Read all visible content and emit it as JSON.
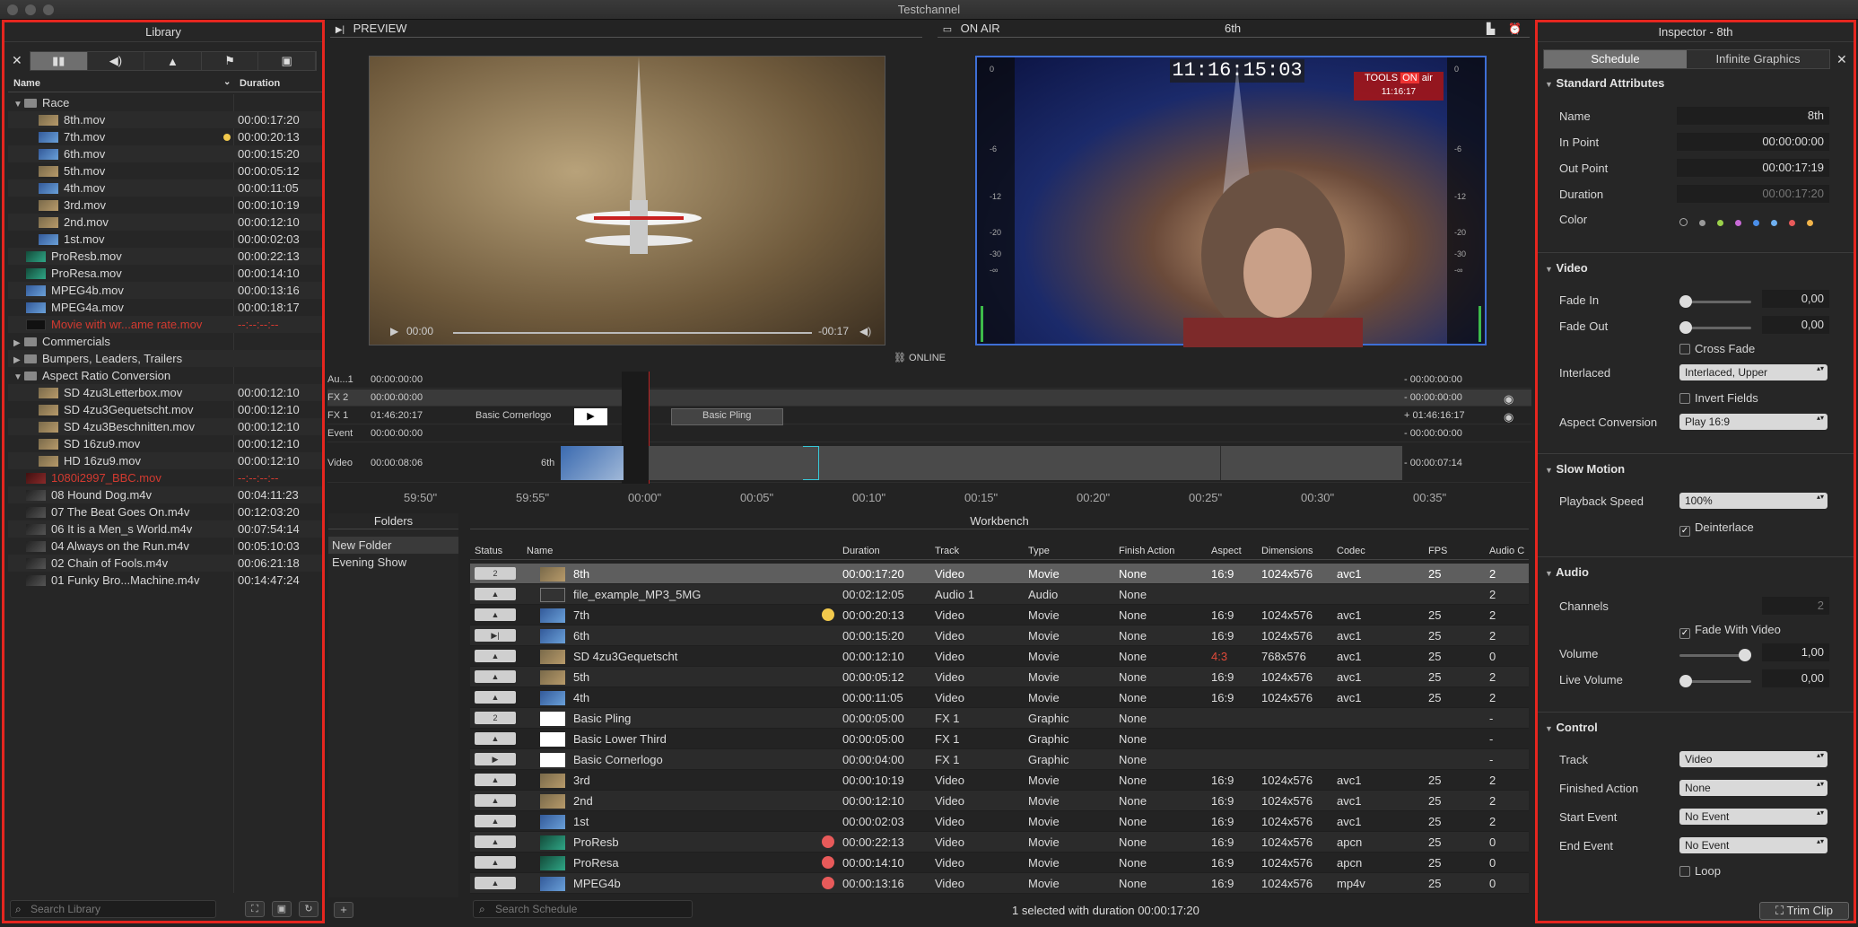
{
  "window": {
    "title": "Testchannel"
  },
  "library": {
    "title": "Library",
    "col_name": "Name",
    "col_duration": "Duration",
    "rows": [
      {
        "name": "Race",
        "dur": "",
        "type": "folder",
        "indent": 0,
        "open": true
      },
      {
        "name": "8th.mov",
        "dur": "00:00:17:20",
        "indent": 2,
        "thumb": "sand"
      },
      {
        "name": "7th.mov",
        "dur": "00:00:20:13",
        "indent": 2,
        "thumb": "blue",
        "dot": true
      },
      {
        "name": "6th.mov",
        "dur": "00:00:15:20",
        "indent": 2,
        "thumb": "blue"
      },
      {
        "name": "5th.mov",
        "dur": "00:00:05:12",
        "indent": 2,
        "thumb": "sand"
      },
      {
        "name": "4th.mov",
        "dur": "00:00:11:05",
        "indent": 2,
        "thumb": "blue"
      },
      {
        "name": "3rd.mov",
        "dur": "00:00:10:19",
        "indent": 2,
        "thumb": "sand"
      },
      {
        "name": "2nd.mov",
        "dur": "00:00:12:10",
        "indent": 2,
        "thumb": "sand"
      },
      {
        "name": "1st.mov",
        "dur": "00:00:02:03",
        "indent": 2,
        "thumb": "blue"
      },
      {
        "name": "ProResb.mov",
        "dur": "00:00:22:13",
        "indent": 1,
        "thumb": "green"
      },
      {
        "name": "ProResa.mov",
        "dur": "00:00:14:10",
        "indent": 1,
        "thumb": "green"
      },
      {
        "name": "MPEG4b.mov",
        "dur": "00:00:13:16",
        "indent": 1,
        "thumb": "blue"
      },
      {
        "name": "MPEG4a.mov",
        "dur": "00:00:18:17",
        "indent": 1,
        "thumb": "blue"
      },
      {
        "name": "Movie with wr...ame rate.mov",
        "dur": "--:--:--:--",
        "indent": 1,
        "thumb": "black",
        "red": true
      },
      {
        "name": "Commercials",
        "dur": "",
        "type": "folder",
        "indent": 0
      },
      {
        "name": "Bumpers, Leaders, Trailers",
        "dur": "",
        "type": "folder",
        "indent": 0
      },
      {
        "name": "Aspect Ratio Conversion",
        "dur": "",
        "type": "folder",
        "indent": 0,
        "open": true
      },
      {
        "name": "SD 4zu3Letterbox.mov",
        "dur": "00:00:12:10",
        "indent": 2,
        "thumb": "sand"
      },
      {
        "name": "SD 4zu3Gequetscht.mov",
        "dur": "00:00:12:10",
        "indent": 2,
        "thumb": "sand"
      },
      {
        "name": "SD 4zu3Beschnitten.mov",
        "dur": "00:00:12:10",
        "indent": 2,
        "thumb": "sand"
      },
      {
        "name": "SD 16zu9.mov",
        "dur": "00:00:12:10",
        "indent": 2,
        "thumb": "sand"
      },
      {
        "name": "HD 16zu9.mov",
        "dur": "00:00:12:10",
        "indent": 2,
        "thumb": "sand"
      },
      {
        "name": "1080i2997_BBC.mov",
        "dur": "--:--:--:--",
        "indent": 1,
        "thumb": "red",
        "red": true
      },
      {
        "name": "08 Hound Dog.m4v",
        "dur": "00:04:11:23",
        "indent": 1,
        "thumb": "dark"
      },
      {
        "name": "07 The Beat Goes On.m4v",
        "dur": "00:12:03:20",
        "indent": 1,
        "thumb": "dark"
      },
      {
        "name": "06 It is a Men_s World.m4v",
        "dur": "00:07:54:14",
        "indent": 1,
        "thumb": "dark"
      },
      {
        "name": "04 Always on the Run.m4v",
        "dur": "00:05:10:03",
        "indent": 1,
        "thumb": "dark"
      },
      {
        "name": "02 Chain of Fools.m4v",
        "dur": "00:06:21:18",
        "indent": 1,
        "thumb": "dark"
      },
      {
        "name": "01 Funky Bro...Machine.m4v",
        "dur": "00:14:47:24",
        "indent": 1,
        "thumb": "dark"
      }
    ],
    "search_placeholder": "Search Library"
  },
  "preview": {
    "label": "PREVIEW",
    "time_left": "00:00",
    "time_right": "-00:17"
  },
  "onair": {
    "label": "ON AIR",
    "clip": "6th",
    "clock": "11:16:15:03",
    "brand_tools": "TOOLS",
    "brand_on": "ON",
    "brand_air": "air",
    "brand_time": "11:16:17",
    "online": "ONLINE",
    "meter": [
      "0",
      "-6",
      "-12",
      "-20",
      "-30",
      "-∞"
    ]
  },
  "timeline": {
    "rows": [
      {
        "label": "Au...1",
        "tc": "00:00:00:00",
        "right": "- 00:00:00:00"
      },
      {
        "label": "FX 2",
        "tc": "00:00:00:00",
        "right": "- 00:00:00:00"
      },
      {
        "label": "FX 1",
        "tc": "01:46:20:17",
        "clip1": "Basic Cornerlogo",
        "clip2": "Basic Pling",
        "right": "+ 01:46:16:17"
      },
      {
        "label": "Event",
        "tc": "00:00:00:00",
        "right": "- 00:00:00:00"
      },
      {
        "label": "Video",
        "tc": "00:00:08:06",
        "clip1": "6th",
        "right": "- 00:00:07:14"
      }
    ],
    "ruler": [
      "59:50\"",
      "59:55\"",
      "00:00\"",
      "00:05\"",
      "00:10\"",
      "00:15\"",
      "00:20\"",
      "00:25\"",
      "00:30\"",
      "00:35\""
    ]
  },
  "folders": {
    "title": "Folders",
    "items": [
      "New Folder",
      "Evening Show"
    ]
  },
  "workbench": {
    "title": "Workbench",
    "columns": [
      "Status",
      "Name",
      "Duration",
      "Track",
      "Type",
      "Finish Action",
      "Aspect",
      "Dimensions",
      "Codec",
      "FPS",
      "Audio C"
    ],
    "rows": [
      {
        "status": "2",
        "name": "8th",
        "dur": "00:00:17:20",
        "track": "Video",
        "type": "Movie",
        "finish": "None",
        "aspect": "16:9",
        "dim": "1024x576",
        "codec": "avc1",
        "fps": "25",
        "audio": "2",
        "sel": true
      },
      {
        "status": "▲",
        "name": "file_example_MP3_5MG",
        "dur": "00:02:12:05",
        "track": "Audio 1",
        "type": "Audio",
        "finish": "None",
        "aspect": "",
        "dim": "",
        "codec": "",
        "fps": "",
        "audio": "2"
      },
      {
        "status": "▲",
        "name": "7th",
        "dur": "00:00:20:13",
        "track": "Video",
        "type": "Movie",
        "finish": "None",
        "aspect": "16:9",
        "dim": "1024x576",
        "codec": "avc1",
        "fps": "25",
        "audio": "2",
        "dot": "#f2c94c"
      },
      {
        "status": "▶|",
        "name": "6th",
        "dur": "00:00:15:20",
        "track": "Video",
        "type": "Movie",
        "finish": "None",
        "aspect": "16:9",
        "dim": "1024x576",
        "codec": "avc1",
        "fps": "25",
        "audio": "2"
      },
      {
        "status": "▲",
        "name": "SD 4zu3Gequetscht",
        "dur": "00:00:12:10",
        "track": "Video",
        "type": "Movie",
        "finish": "None",
        "aspect": "4:3",
        "dim": "768x576",
        "codec": "avc1",
        "fps": "25",
        "audio": "0",
        "aspect_red": true
      },
      {
        "status": "▲",
        "name": "5th",
        "dur": "00:00:05:12",
        "track": "Video",
        "type": "Movie",
        "finish": "None",
        "aspect": "16:9",
        "dim": "1024x576",
        "codec": "avc1",
        "fps": "25",
        "audio": "2"
      },
      {
        "status": "▲",
        "name": "4th",
        "dur": "00:00:11:05",
        "track": "Video",
        "type": "Movie",
        "finish": "None",
        "aspect": "16:9",
        "dim": "1024x576",
        "codec": "avc1",
        "fps": "25",
        "audio": "2"
      },
      {
        "status": "2",
        "name": "Basic Pling",
        "dur": "00:00:05:00",
        "track": "FX 1",
        "type": "Graphic",
        "finish": "None",
        "aspect": "",
        "dim": "",
        "codec": "",
        "fps": "",
        "audio": "-"
      },
      {
        "status": "▲",
        "name": "Basic Lower Third",
        "dur": "00:00:05:00",
        "track": "FX 1",
        "type": "Graphic",
        "finish": "None",
        "aspect": "",
        "dim": "",
        "codec": "",
        "fps": "",
        "audio": "-"
      },
      {
        "status": "▶",
        "name": "Basic Cornerlogo",
        "dur": "00:00:04:00",
        "track": "FX 1",
        "type": "Graphic",
        "finish": "None",
        "aspect": "",
        "dim": "",
        "codec": "",
        "fps": "",
        "audio": "-"
      },
      {
        "status": "▲",
        "name": "3rd",
        "dur": "00:00:10:19",
        "track": "Video",
        "type": "Movie",
        "finish": "None",
        "aspect": "16:9",
        "dim": "1024x576",
        "codec": "avc1",
        "fps": "25",
        "audio": "2"
      },
      {
        "status": "▲",
        "name": "2nd",
        "dur": "00:00:12:10",
        "track": "Video",
        "type": "Movie",
        "finish": "None",
        "aspect": "16:9",
        "dim": "1024x576",
        "codec": "avc1",
        "fps": "25",
        "audio": "2"
      },
      {
        "status": "▲",
        "name": "1st",
        "dur": "00:00:02:03",
        "track": "Video",
        "type": "Movie",
        "finish": "None",
        "aspect": "16:9",
        "dim": "1024x576",
        "codec": "avc1",
        "fps": "25",
        "audio": "2"
      },
      {
        "status": "▲",
        "name": "ProResb",
        "dur": "00:00:22:13",
        "track": "Video",
        "type": "Movie",
        "finish": "None",
        "aspect": "16:9",
        "dim": "1024x576",
        "codec": "apcn",
        "fps": "25",
        "audio": "0",
        "dot": "#e85a5a"
      },
      {
        "status": "▲",
        "name": "ProResa",
        "dur": "00:00:14:10",
        "track": "Video",
        "type": "Movie",
        "finish": "None",
        "aspect": "16:9",
        "dim": "1024x576",
        "codec": "apcn",
        "fps": "25",
        "audio": "0",
        "dot": "#e85a5a"
      },
      {
        "status": "▲",
        "name": "MPEG4b",
        "dur": "00:00:13:16",
        "track": "Video",
        "type": "Movie",
        "finish": "None",
        "aspect": "16:9",
        "dim": "1024x576",
        "codec": "mp4v",
        "fps": "25",
        "audio": "0",
        "dot": "#e85a5a"
      }
    ],
    "search_placeholder": "Search Schedule",
    "status_text": "1 selected with duration 00:00:17:20"
  },
  "inspector": {
    "title": "Inspector - 8th",
    "tab_schedule": "Schedule",
    "tab_graphics": "Infinite Graphics",
    "std": {
      "title": "Standard Attributes",
      "name_l": "Name",
      "name_v": "8th",
      "in_l": "In Point",
      "in_v": "00:00:00:00",
      "out_l": "Out Point",
      "out_v": "00:00:17:19",
      "dur_l": "Duration",
      "dur_v": "00:00:17:20",
      "color_l": "Color"
    },
    "colors": [
      "#888888",
      "#9a9a9a",
      "#9bd14a",
      "#c86ad6",
      "#4a8ee8",
      "#6fb0f0",
      "#e85a5a",
      "#f2b44a"
    ],
    "video": {
      "title": "Video",
      "fadein_l": "Fade In",
      "fadein_v": "0,00",
      "fadeout_l": "Fade Out",
      "fadeout_v": "0,00",
      "crossfade": "Cross Fade",
      "interlaced_l": "Interlaced",
      "interlaced_v": "Interlaced, Upper",
      "invert": "Invert Fields",
      "aspect_l": "Aspect Conversion",
      "aspect_v": "Play 16:9"
    },
    "slow": {
      "title": "Slow Motion",
      "speed_l": "Playback Speed",
      "speed_v": "100%",
      "deinterlace": "Deinterlace"
    },
    "audio": {
      "title": "Audio",
      "channels_l": "Channels",
      "channels_v": "2",
      "fade_with_video": "Fade With Video",
      "volume_l": "Volume",
      "volume_v": "1,00",
      "volume_level": 1.0,
      "live_l": "Live Volume",
      "live_v": "0,00"
    },
    "control": {
      "title": "Control",
      "track_l": "Track",
      "track_v": "Video",
      "finished_l": "Finished Action",
      "finished_v": "None",
      "start_l": "Start Event",
      "start_v": "No Event",
      "end_l": "End Event",
      "end_v": "No Event",
      "loop": "Loop"
    },
    "trim": "Trim Clip"
  }
}
